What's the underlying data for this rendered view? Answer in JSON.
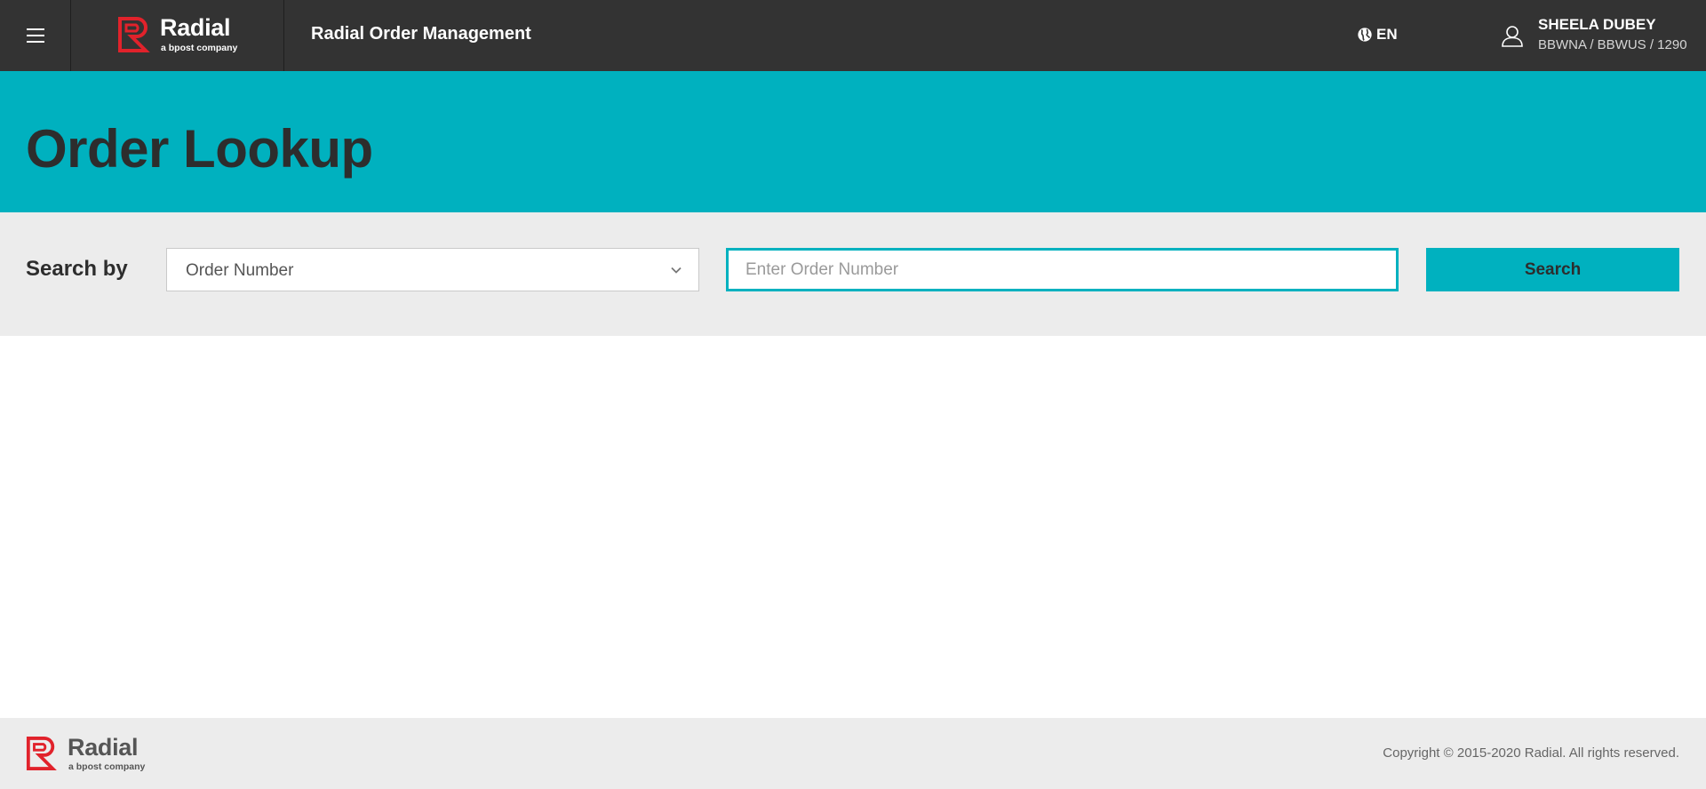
{
  "header": {
    "menu_icon": "hamburger-menu-icon",
    "logo": {
      "name": "Radial",
      "tagline": "a bpost company",
      "brand_color": "#e1222b"
    },
    "app_title": "Radial Order Management",
    "language": {
      "icon": "globe-icon",
      "label": "EN"
    },
    "user": {
      "icon": "user-icon",
      "name": "SHEELA DUBEY",
      "org": "BBWNA / BBWUS / 1290"
    }
  },
  "hero": {
    "title": "Order Lookup",
    "background": "#00b1bf"
  },
  "search": {
    "label": "Search by",
    "type_select": {
      "value": "Order Number",
      "icon": "chevron-down-icon"
    },
    "input": {
      "value": "",
      "placeholder": "Enter Order Number"
    },
    "button_label": "Search"
  },
  "footer": {
    "logo": {
      "name": "Radial",
      "tagline": "a bpost company"
    },
    "copyright": "Copyright © 2015-2020 Radial. All rights reserved."
  },
  "colors": {
    "topbar": "#333333",
    "accent": "#00b1bf",
    "panel": "#ececec",
    "text_dark": "#2d2d2d"
  }
}
